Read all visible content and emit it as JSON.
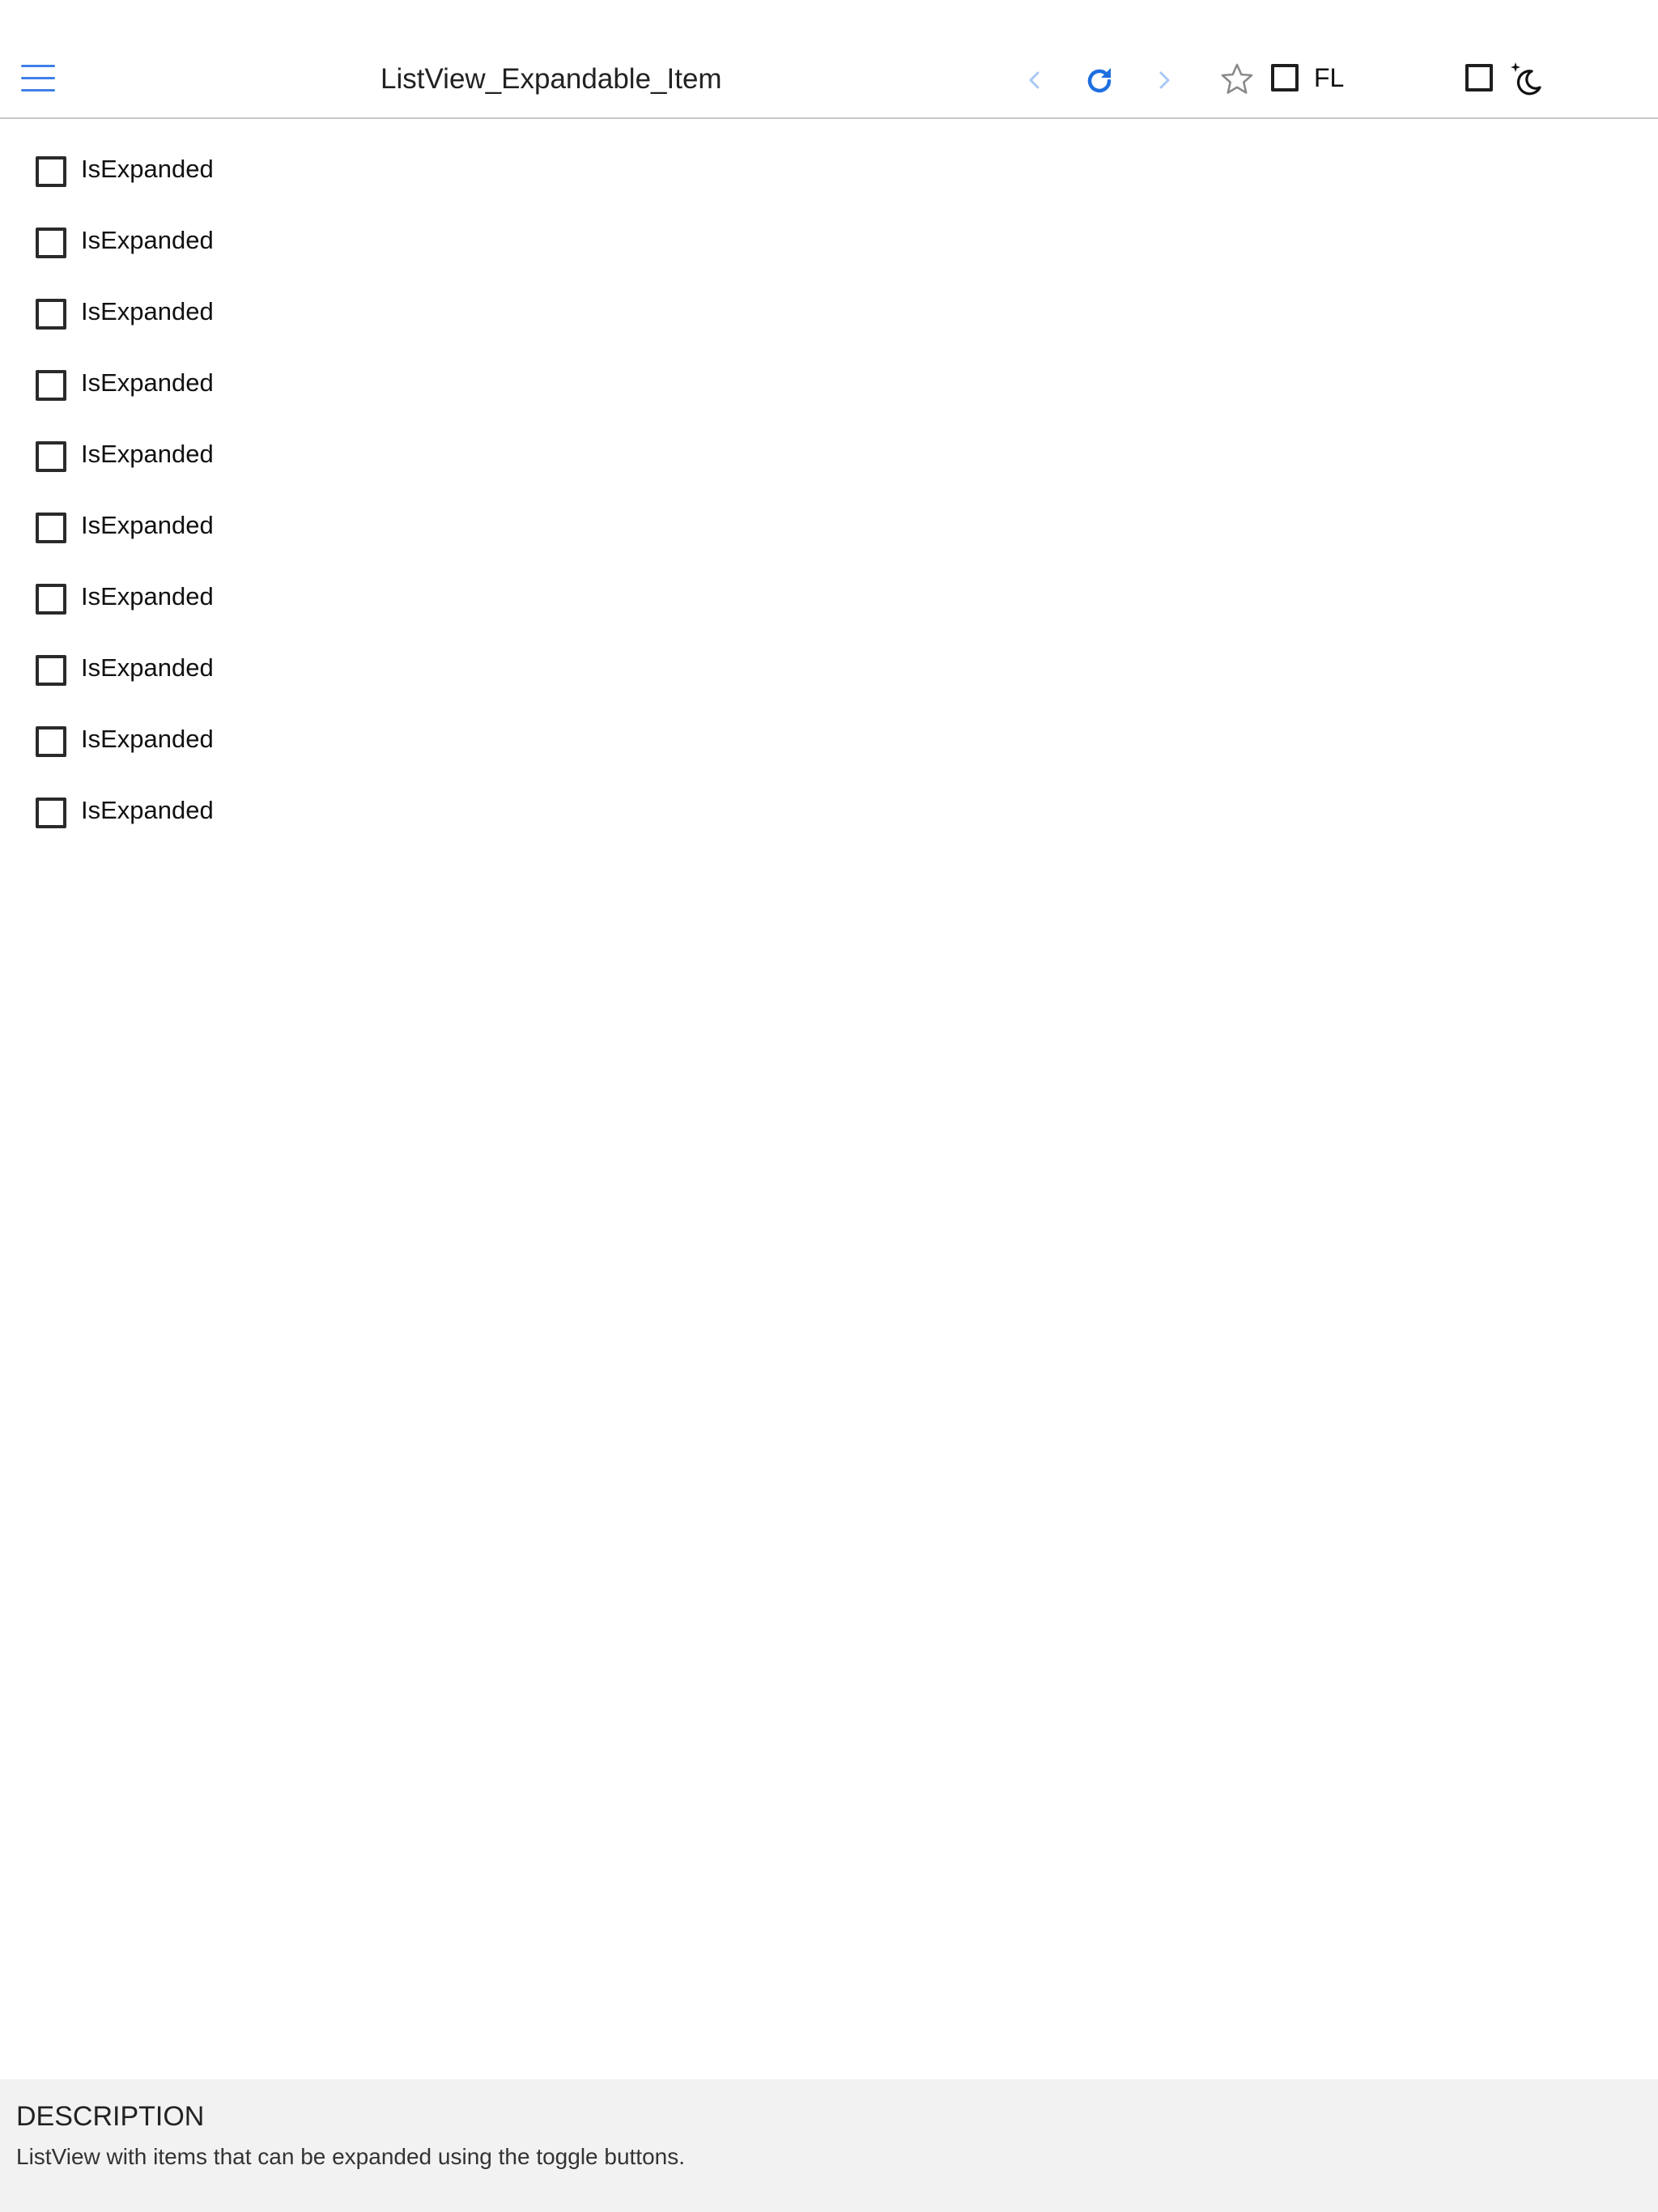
{
  "header": {
    "title": "ListView_Expandable_Item",
    "menu_icon": "hamburger-menu-icon",
    "back_icon": "chevron-left-icon",
    "refresh_icon": "refresh-icon",
    "forward_icon": "chevron-right-icon",
    "favorite_icon": "star-outline-icon",
    "flow_checkbox_label": "FL",
    "theme_icon": "moon-sparkle-icon",
    "accent_color": "#3f80e8",
    "disabled_nav_color": "#a9c8f5"
  },
  "list": {
    "items": [
      {
        "label": "IsExpanded",
        "checked": false
      },
      {
        "label": "IsExpanded",
        "checked": false
      },
      {
        "label": "IsExpanded",
        "checked": false
      },
      {
        "label": "IsExpanded",
        "checked": false
      },
      {
        "label": "IsExpanded",
        "checked": false
      },
      {
        "label": "IsExpanded",
        "checked": false
      },
      {
        "label": "IsExpanded",
        "checked": false
      },
      {
        "label": "IsExpanded",
        "checked": false
      },
      {
        "label": "IsExpanded",
        "checked": false
      },
      {
        "label": "IsExpanded",
        "checked": false
      }
    ]
  },
  "description": {
    "title": "DESCRIPTION",
    "text": "ListView with items that can be expanded using the toggle buttons."
  }
}
